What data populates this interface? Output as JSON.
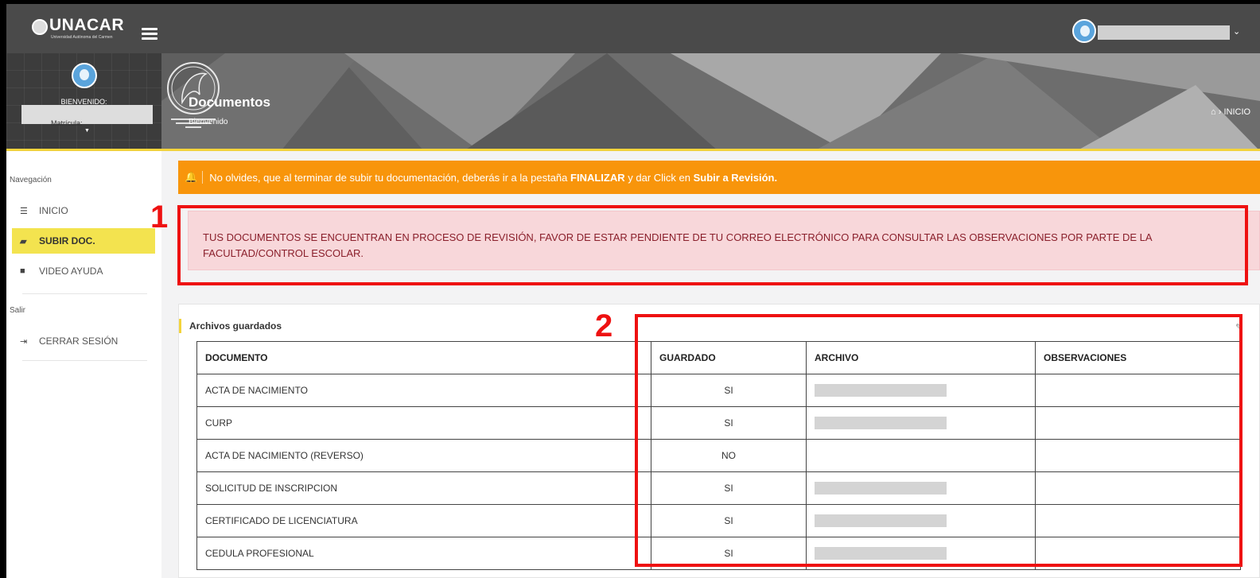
{
  "app": {
    "logo_text": "UNACAR",
    "logo_sub": "Universidad Autónoma del Carmen"
  },
  "sidebar": {
    "welcome": "BIENVENIDO:",
    "matricula_label": "Matrícula:",
    "nav_heading": "Navegación",
    "items": [
      {
        "label": "INICIO",
        "icon": "list-icon"
      },
      {
        "label": "SUBIR DOC.",
        "icon": "folder-open-icon",
        "active": true
      },
      {
        "label": "VIDEO AYUDA",
        "icon": "video-camera-icon"
      }
    ],
    "exit_heading": "Salir",
    "logout_label": "CERRAR SESIÓN"
  },
  "header": {
    "title": "Documentos",
    "subtitle": "Bienvenido",
    "breadcrumb": "› INICIO"
  },
  "alerts": {
    "warning_prefix": "No olvides, que al terminar de subir tu documentación, deberás ir a la pestaña",
    "warning_tab": "FINALIZAR",
    "warning_mid": "y dar Click en",
    "warning_action": "Subir a Revisión.",
    "notice": "TUS DOCUMENTOS SE ENCUENTRAN EN PROCESO DE REVISIÓN, FAVOR DE ESTAR PENDIENTE DE TU CORREO ELECTRÓNICO PARA CONSULTAR LAS OBSERVACIONES POR PARTE DE LA FACULTAD/CONTROL ESCOLAR."
  },
  "annotations": {
    "one": "1",
    "two": "2"
  },
  "panel": {
    "title": "Archivos guardados",
    "columns": [
      "DOCUMENTO",
      "GUARDADO",
      "ARCHIVO",
      "OBSERVACIONES"
    ],
    "rows": [
      {
        "documento": "ACTA DE NACIMIENTO",
        "guardado": "SI",
        "has_file": true
      },
      {
        "documento": "CURP",
        "guardado": "SI",
        "has_file": true
      },
      {
        "documento": "ACTA DE NACIMIENTO (REVERSO)",
        "guardado": "NO",
        "has_file": false
      },
      {
        "documento": "SOLICITUD DE INSCRIPCION",
        "guardado": "SI",
        "has_file": true
      },
      {
        "documento": "CERTIFICADO DE LICENCIATURA",
        "guardado": "SI",
        "has_file": true
      },
      {
        "documento": "CEDULA PROFESIONAL",
        "guardado": "SI",
        "has_file": true
      }
    ]
  },
  "colors": {
    "accent_yellow": "#f3d33b",
    "warning_orange": "#f8950b",
    "annotation_red": "#ee1111"
  }
}
